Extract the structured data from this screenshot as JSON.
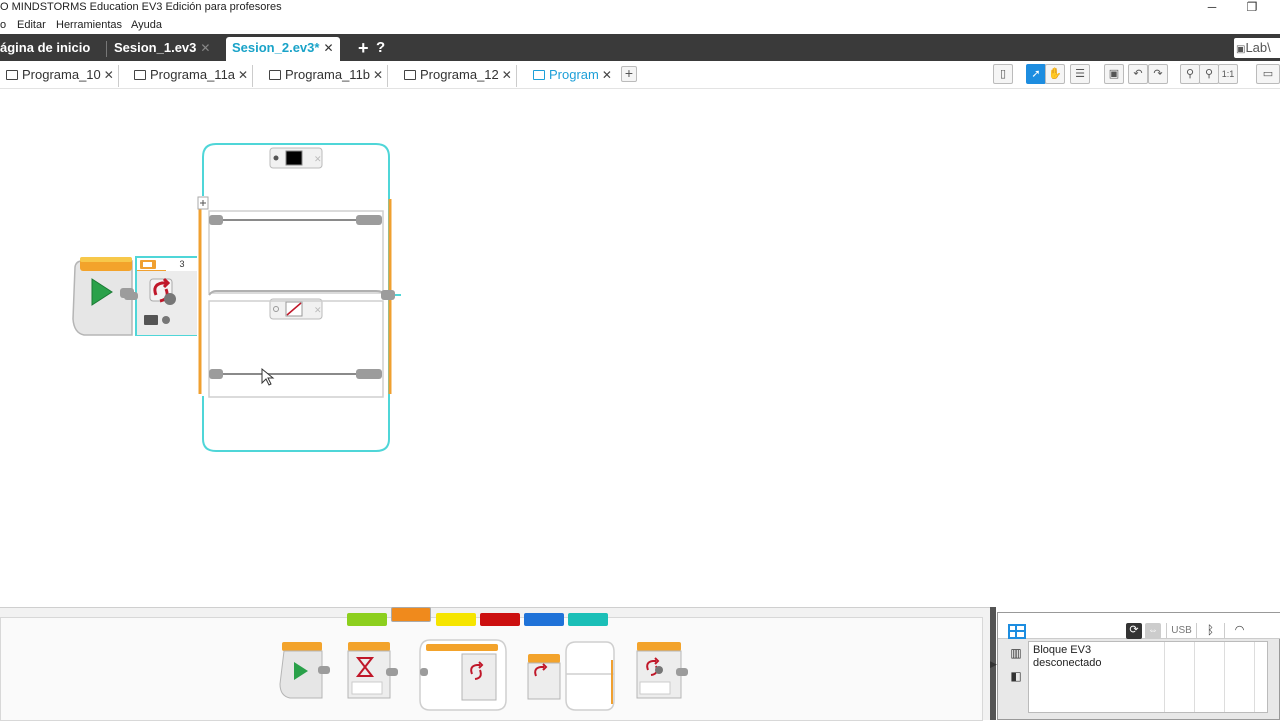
{
  "window": {
    "title": "O MINDSTORMS Education EV3 Edición para profesores",
    "minimize_icon": "minimize-icon",
    "restore_icon": "restore-icon"
  },
  "menu": {
    "items": [
      "o",
      "Editar",
      "Herramientas",
      "Ayuda"
    ]
  },
  "project_tabs": {
    "items": [
      {
        "label": "ágina de inicio"
      },
      {
        "label": "Sesion_1.ev3"
      },
      {
        "label": "Sesion_2.ev3*"
      }
    ],
    "close_glyph": "✕",
    "add_glyph": "+",
    "help_glyph": "?",
    "labview_label": "Lab\\"
  },
  "program_tabs": {
    "items": [
      {
        "label": "Programa_10"
      },
      {
        "label": "Programa_11a"
      },
      {
        "label": "Programa_11b"
      },
      {
        "label": "Programa_12"
      },
      {
        "label": "Program"
      }
    ],
    "close_glyph": "✕",
    "add_glyph": "+",
    "zoom_label": "1:1"
  },
  "canvas": {
    "loop_count": "3"
  },
  "palette": {
    "colors": [
      "#8ccf1e",
      "#f08a1c",
      "#f6e500",
      "#cc1010",
      "#1f72d8",
      "#1bbfb7"
    ]
  },
  "hardware": {
    "usb_label": "USB",
    "status_line1": "Bloque EV3",
    "status_line2": "desconectado"
  }
}
